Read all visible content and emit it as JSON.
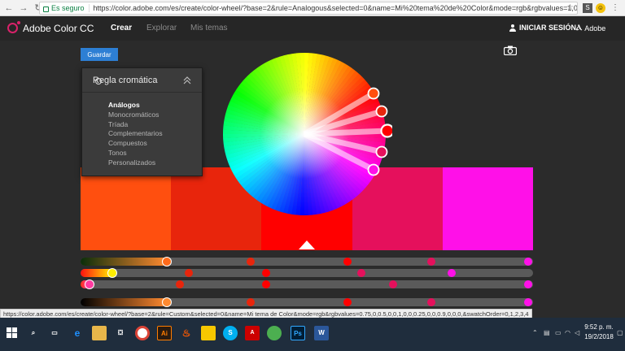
{
  "browser": {
    "secure_label": "Es seguro",
    "url": "https://color.adobe.com/es/create/color-wheel/?base=2&rule=Analogous&selected=0&name=Mi%20tema%20de%20Color&mode=rgb&rgbvalues=1,0.3270833333...",
    "status_url": "https://color.adobe.com/es/create/color-wheel/?base=2&rule=Custom&selected=0&name=Mi tema de Color&mode=rgb&rgbvalues=0.75,0,0.5,0,0,1,0,0,0.25,0,0,0.9,0,0,0,&swatchOrder=0,1,2,3,4"
  },
  "app": {
    "title": "Adobe Color CC",
    "tabs": {
      "create": "Crear",
      "explore": "Explorar",
      "my_themes": "Mis temas"
    },
    "signin": "INICIAR SESIÓN",
    "adobe": "Adobe"
  },
  "toolbar": {
    "save_label": "Guardar"
  },
  "rule_panel": {
    "title": "Regla cromática",
    "options": [
      "Análogos",
      "Monocromáticos",
      "Tríada",
      "Complementarios",
      "Compuestos",
      "Tonos",
      "Personalizados"
    ],
    "selected": "Análogos"
  },
  "swatches": [
    "#ff4f0f",
    "#e8250c",
    "#ff0000",
    "#e5105c",
    "#ff10e8"
  ],
  "sliders": [
    {
      "thumbs": [
        0.19,
        0.375,
        0.59,
        0.775,
        0.99
      ],
      "fill": "#ff6a1a",
      "gradient": "linear-gradient(to right, #0a2e0a, #ff8a30)"
    },
    {
      "thumbs": [
        0.07,
        0.24,
        0.41,
        0.62,
        0.82
      ],
      "fill": "#ffee00",
      "gradient": "linear-gradient(to right, #ff1010, #ffee00)"
    },
    {
      "thumbs": [
        0.02,
        0.22,
        0.41,
        0.69,
        0.99
      ],
      "fill": "#ff3aa0",
      "gradient": "linear-gradient(to right, #ff3010, #ff40c0)"
    },
    {
      "thumbs": [
        0.19,
        0.375,
        0.59,
        0.775,
        0.99
      ],
      "fill": "#ff8a30",
      "gradient": "linear-gradient(to right, #000000, #ff8a30)"
    }
  ],
  "taskbar": {
    "time": "9:52 p. m.",
    "date": "19/2/2018"
  }
}
